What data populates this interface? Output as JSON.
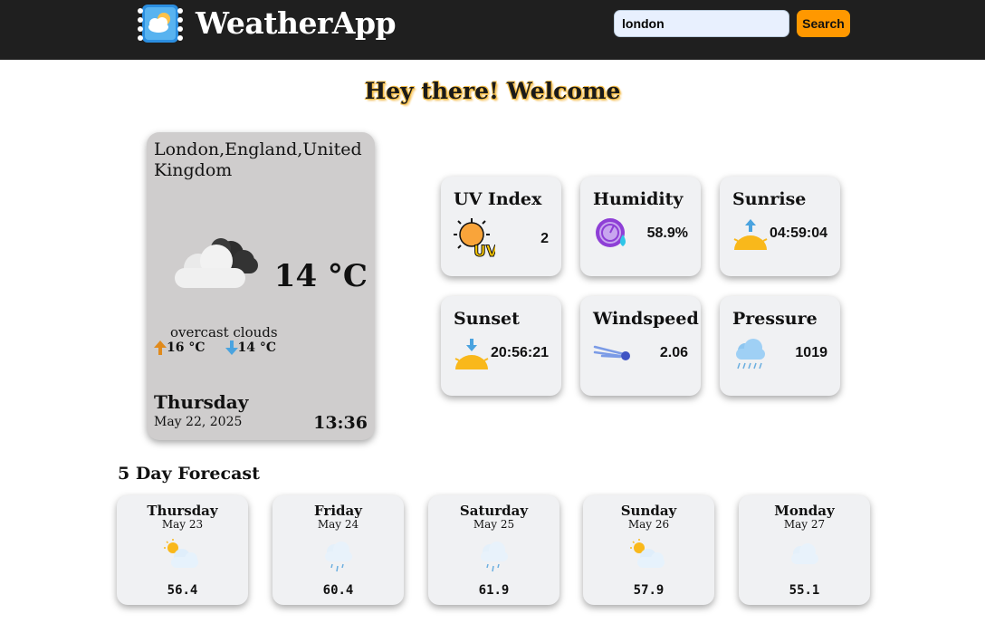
{
  "header": {
    "app_title": "WeatherApp",
    "search_value": "london",
    "search_button": "Search"
  },
  "welcome": "Hey there! Welcome",
  "current": {
    "location": "London,England,United Kingdom",
    "temperature": "14 °C",
    "description": "overcast clouds",
    "temp_max": "16 °C",
    "temp_min": "14 °C",
    "day": "Thursday",
    "date": "May 22, 2025",
    "time": "13:36",
    "icon": "overcast-clouds-icon"
  },
  "stats": [
    {
      "title": "UV Index",
      "value": "2",
      "icon": "uv-icon"
    },
    {
      "title": "Humidity",
      "value": "58.9%",
      "icon": "humidity-icon"
    },
    {
      "title": "Sunrise",
      "value": "04:59:04",
      "icon": "sunrise-icon"
    },
    {
      "title": "Sunset",
      "value": "20:56:21",
      "icon": "sunset-icon"
    },
    {
      "title": "Windspeed",
      "value": "2.06",
      "icon": "wind-icon"
    },
    {
      "title": "Pressure",
      "value": "1019",
      "icon": "pressure-icon"
    }
  ],
  "forecast_title": "5 Day Forecast",
  "forecast": [
    {
      "day": "Thursday",
      "date": "May 23",
      "temp": "56.4",
      "icon": "partly-cloudy-icon"
    },
    {
      "day": "Friday",
      "date": "May 24",
      "temp": "60.4",
      "icon": "rain-icon"
    },
    {
      "day": "Saturday",
      "date": "May 25",
      "temp": "61.9",
      "icon": "rain-icon"
    },
    {
      "day": "Sunday",
      "date": "May 26",
      "temp": "57.9",
      "icon": "partly-cloudy-icon"
    },
    {
      "day": "Monday",
      "date": "May 27",
      "temp": "55.1",
      "icon": "cloud-icon"
    }
  ],
  "colors": {
    "header_bg": "#1f1f1f",
    "accent": "#ff9800",
    "main_card_bg": "#cfcdcd",
    "card_bg": "#f0f1f3"
  }
}
